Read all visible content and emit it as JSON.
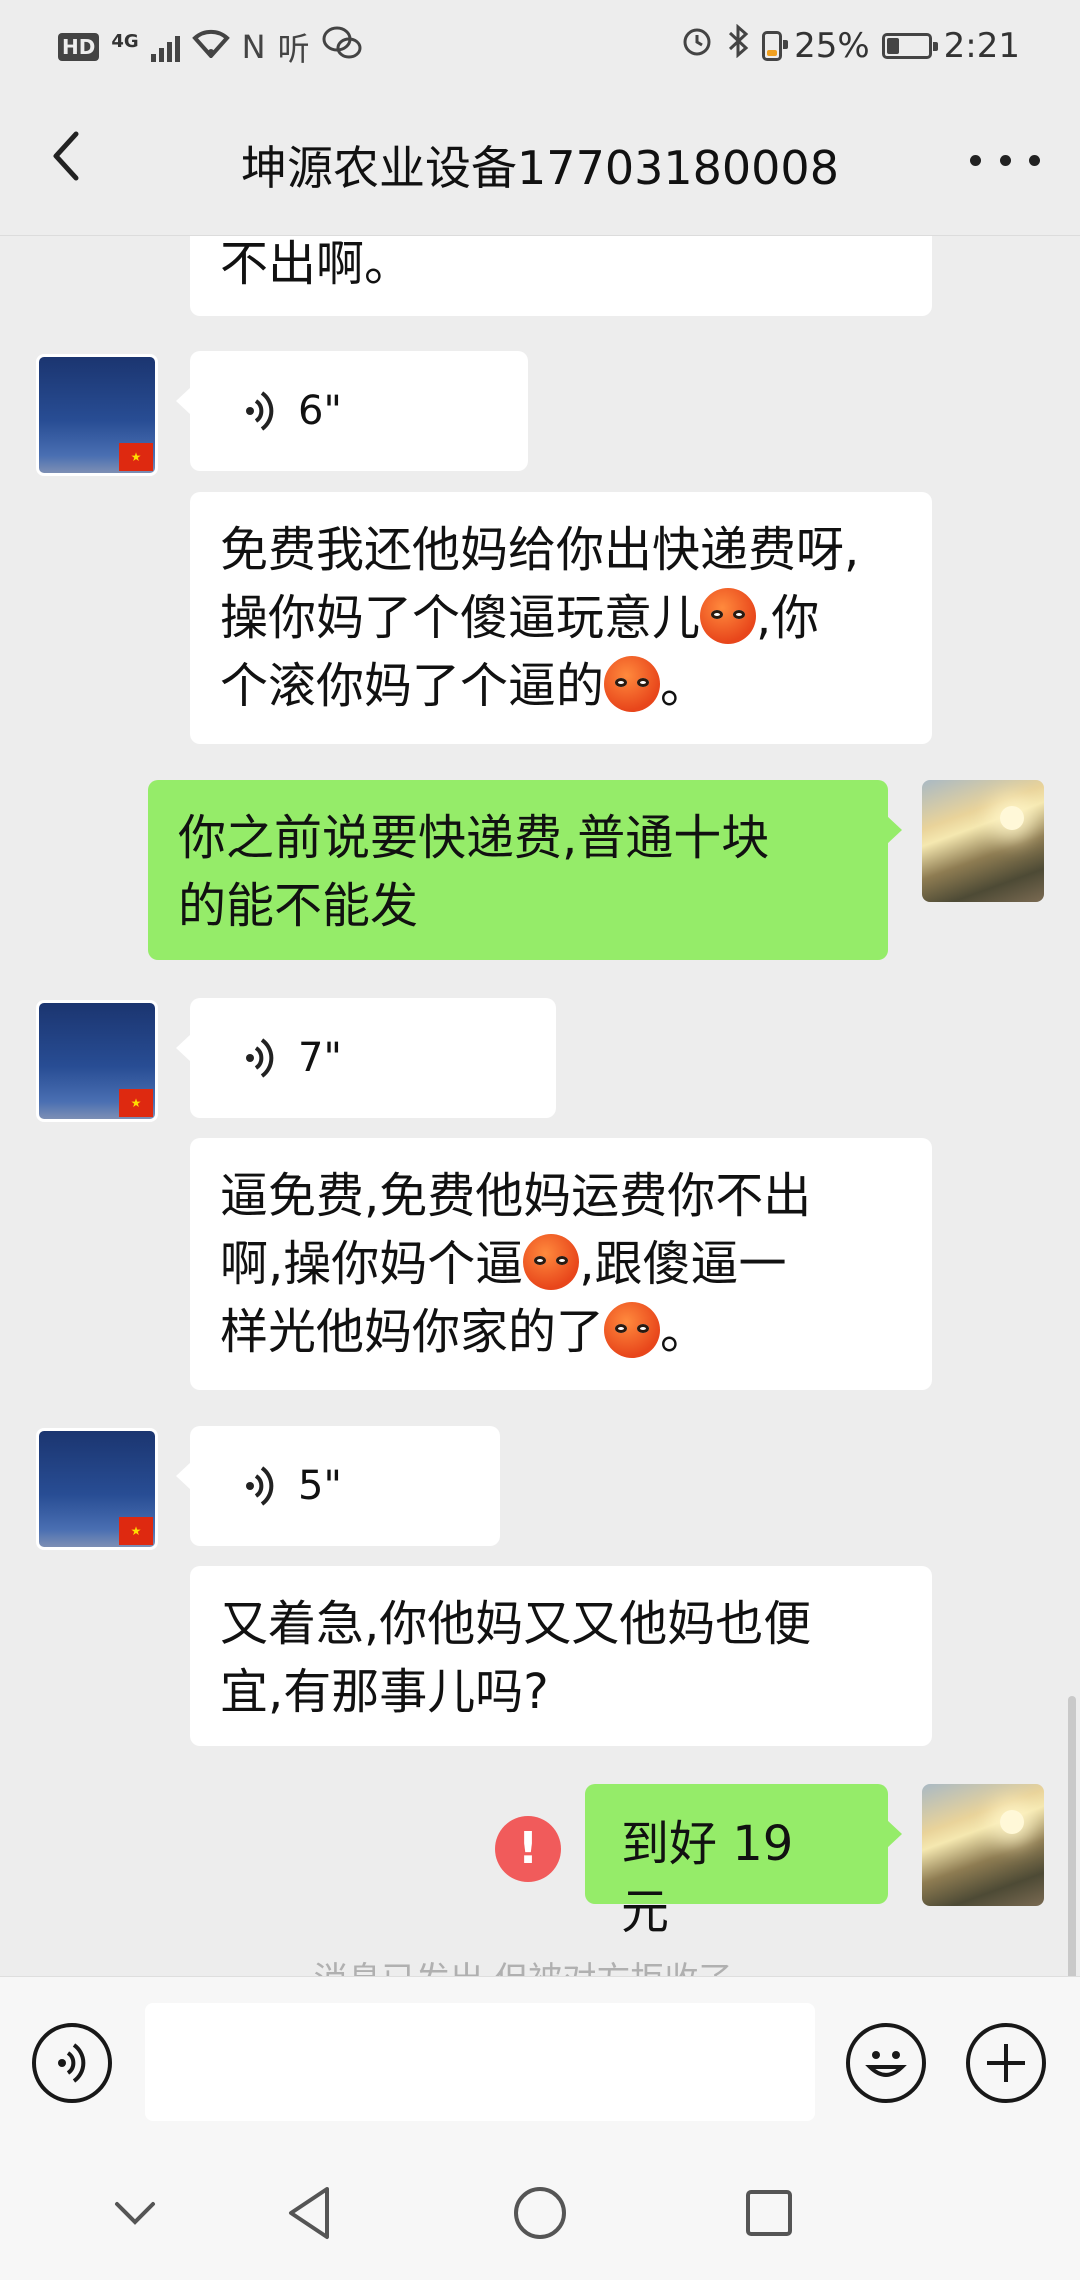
{
  "status_bar": {
    "hd": "HD",
    "network": "4G",
    "nfc": "N",
    "listen": "听",
    "battery_pct": "25%",
    "time": "2:21"
  },
  "header": {
    "title": "坤源农业设备17703180008",
    "back_icon": "chevron-left-icon",
    "more_icon": "more-dots-icon"
  },
  "messages": [
    {
      "type": "text",
      "side": "left",
      "text": "不出啊。"
    },
    {
      "type": "voice",
      "side": "left",
      "duration": "6\""
    },
    {
      "type": "text",
      "side": "left",
      "segments": [
        "免费我还他妈给你出快递费呀,",
        "操你妈了个傻逼玩意儿",
        ",你",
        "个滚你妈了个逼的",
        "。"
      ]
    },
    {
      "type": "text",
      "side": "right",
      "segments": [
        "你之前说要快递费,普通十块",
        "的能不能发"
      ]
    },
    {
      "type": "voice",
      "side": "left",
      "duration": "7\""
    },
    {
      "type": "text",
      "side": "left",
      "segments": [
        "逼免费,免费他妈运费你不出",
        "啊,操你妈个逼",
        ",跟傻逼一",
        "样光他妈你家的了",
        "。"
      ]
    },
    {
      "type": "voice",
      "side": "left",
      "duration": "5\""
    },
    {
      "type": "text",
      "side": "left",
      "segments": [
        "又着急,你他妈又又他妈也便",
        "宜,有那事儿吗?"
      ]
    },
    {
      "type": "text",
      "side": "right",
      "text": "到好 19 元",
      "failed_icon": "!"
    },
    {
      "type": "system",
      "text": "消息已发出,但被对方拒收了。"
    }
  ],
  "input_bar": {
    "voice_icon": "voice-input-icon",
    "emoji_icon": "emoji-icon",
    "plus_icon": "plus-icon"
  },
  "nav_bar": {
    "icons": [
      "chevron-down-icon",
      "back-triangle-icon",
      "home-circle-icon",
      "recents-square-icon"
    ]
  },
  "colors": {
    "background": "#ededed",
    "sent_bubble": "#95ec69",
    "received_bubble": "#ffffff",
    "fail_red": "#f15b5b"
  }
}
